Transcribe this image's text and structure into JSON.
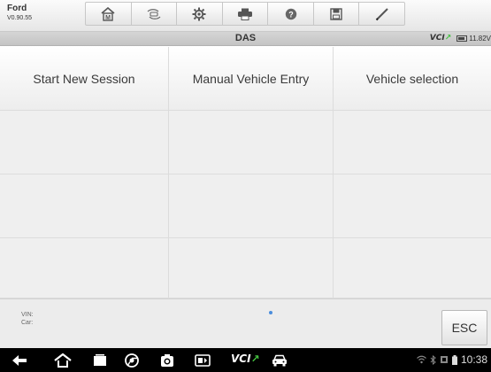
{
  "header": {
    "brand": "Ford",
    "version": "V0.90.55",
    "tools": [
      {
        "icon": "home-icon"
      },
      {
        "icon": "vehicle-swap-icon"
      },
      {
        "icon": "gear-icon"
      },
      {
        "icon": "printer-icon"
      },
      {
        "icon": "help-icon"
      },
      {
        "icon": "save-icon"
      },
      {
        "icon": "pen-icon"
      }
    ]
  },
  "titlebar": {
    "title": "DAS",
    "vci_logo": "VCI",
    "battery_voltage": "11.82V"
  },
  "menu": {
    "rows": [
      [
        "Start New Session",
        "Manual Vehicle Entry",
        "Vehicle selection"
      ],
      [
        "",
        "",
        ""
      ],
      [
        "",
        "",
        ""
      ],
      [
        "",
        "",
        ""
      ]
    ]
  },
  "footer": {
    "vin_label": "VIN:",
    "car_label": "Car:",
    "esc_label": "ESC"
  },
  "navbar": {
    "vci_label": "VCI",
    "clock": "10:38"
  },
  "colors": {
    "accent_green": "#44c040",
    "page_dot": "#4a8ddc"
  }
}
